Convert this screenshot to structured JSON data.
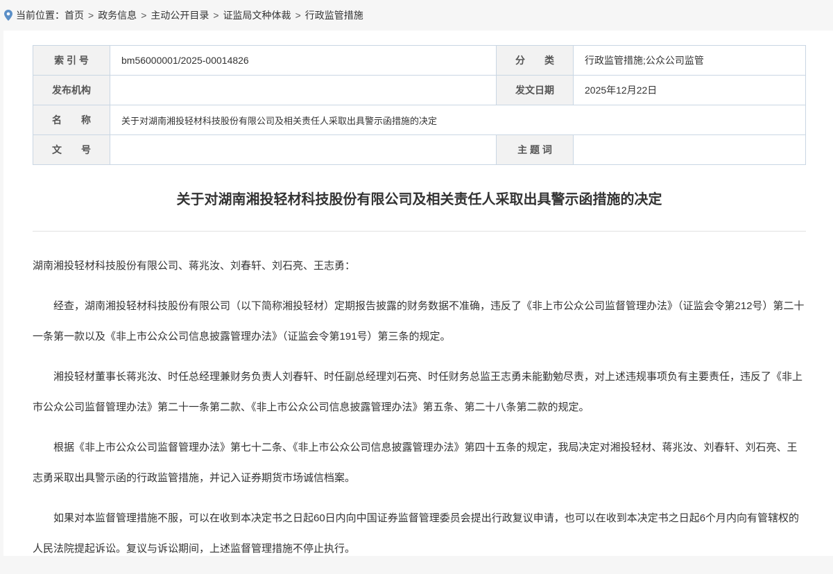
{
  "breadcrumb": {
    "prefix": "当前位置：",
    "items": [
      "首页",
      "政务信息",
      "主动公开目录",
      "证监局文种体裁",
      "行政监管措施"
    ],
    "separator": ">"
  },
  "meta": {
    "index_label": "索 引 号",
    "index_value": "bm56000001/2025-00014826",
    "category_label": "分　　类",
    "category_value": "行政监管措施;公众公司监管",
    "publisher_label": "发布机构",
    "publisher_value": "",
    "date_label": "发文日期",
    "date_value": "2025年12月22日",
    "name_label": "名　　称",
    "name_value": "关于对湖南湘投轻材科技股份有限公司及相关责任人采取出具警示函措施的决定",
    "docno_label": "文　　号",
    "docno_value": "",
    "keywords_label": "主 题 词",
    "keywords_value": ""
  },
  "article": {
    "title": "关于对湖南湘投轻材科技股份有限公司及相关责任人采取出具警示函措施的决定",
    "salutation": "湖南湘投轻材科技股份有限公司、蒋兆汝、刘春轩、刘石亮、王志勇：",
    "paragraphs": [
      "经查，湖南湘投轻材科技股份有限公司（以下简称湘投轻材）定期报告披露的财务数据不准确，违反了《非上市公众公司监督管理办法》（证监会令第212号）第二十一条第一款以及《非上市公众公司信息披露管理办法》（证监会令第191号）第三条的规定。",
      "湘投轻材董事长蒋兆汝、时任总经理兼财务负责人刘春轩、时任副总经理刘石亮、时任财务总监王志勇未能勤勉尽责，对上述违规事项负有主要责任，违反了《非上市公众公司监督管理办法》第二十一条第二款、《非上市公众公司信息披露管理办法》第五条、第二十八条第二款的规定。",
      "根据《非上市公众公司监督管理办法》第七十二条、《非上市公众公司信息披露管理办法》第四十五条的规定，我局决定对湘投轻材、蒋兆汝、刘春轩、刘石亮、王志勇采取出具警示函的行政监管措施，并记入证券期货市场诚信档案。",
      "如果对本监督管理措施不服，可以在收到本决定书之日起60日内向中国证券监督管理委员会提出行政复议申请，也可以在收到本决定书之日起6个月内向有管辖权的人民法院提起诉讼。复议与诉讼期间，上述监督管理措施不停止执行。"
    ]
  },
  "colors": {
    "pin": "#5b8fc7",
    "border": "#c9d6e3",
    "label_bg": "#f2f2f2"
  }
}
